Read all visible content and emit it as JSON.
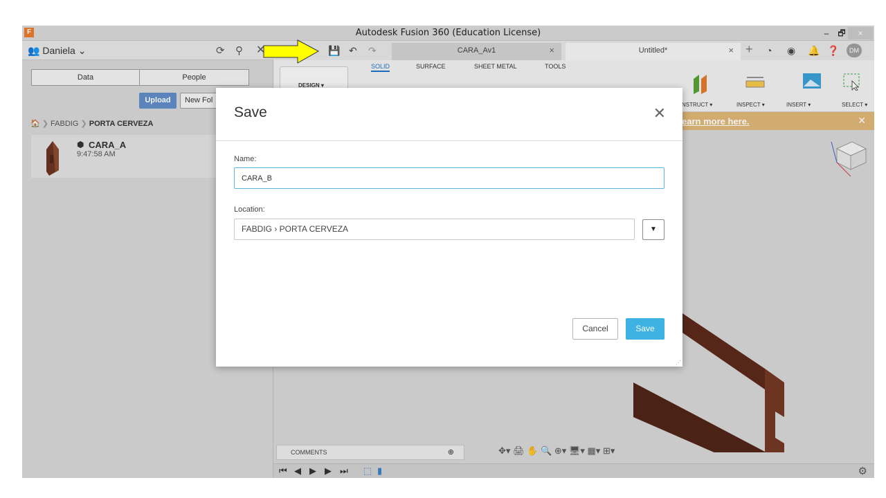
{
  "window": {
    "title": "Autodesk Fusion 360 (Education License)",
    "minimize": "–",
    "restore": "🗗",
    "close": "×"
  },
  "data_panel": {
    "user": "Daniela",
    "tabs": [
      "Data",
      "People"
    ],
    "upload_label": "Upload",
    "new_folder_label": "New Fol",
    "breadcrumb": [
      "FABDIG",
      "PORTA CERVEZA"
    ],
    "file": {
      "name": "CARA_A",
      "time": "9:47:58 AM"
    }
  },
  "doc_tabs": [
    {
      "label": "CARA_Av1"
    },
    {
      "label": "Untitled*"
    }
  ],
  "user_initials": "DM",
  "toolbar": {
    "tabs": [
      "SOLID",
      "SURFACE",
      "SHEET METAL",
      "TOOLS"
    ],
    "design_label": "DESIGN ▾",
    "groups": [
      "NSTRUCT ▾",
      "INSPECT ▾",
      "INSERT ▾",
      "SELECT ▾"
    ]
  },
  "banner": {
    "link": "earn more here."
  },
  "comments_label": "COMMENTS",
  "dialog": {
    "title": "Save",
    "name_label": "Name:",
    "name_value": "CARA_B",
    "location_label": "Location:",
    "location_value": "FABDIG › PORTA CERVEZA",
    "cancel_label": "Cancel",
    "save_label": "Save"
  },
  "colors": {
    "accent_blue": "#3db2e3",
    "upload_blue": "#5f8cc6",
    "banner": "#ddb577",
    "arrow_yellow": "#ffff00",
    "wood": "#6b3322"
  },
  "icons": [
    "grid-icon",
    "save-icon",
    "undo-icon",
    "redo-icon",
    "refresh-icon",
    "search-icon",
    "home-icon",
    "gear-icon",
    "help-icon",
    "bell-icon",
    "plus-icon",
    "view-cube-icon"
  ]
}
